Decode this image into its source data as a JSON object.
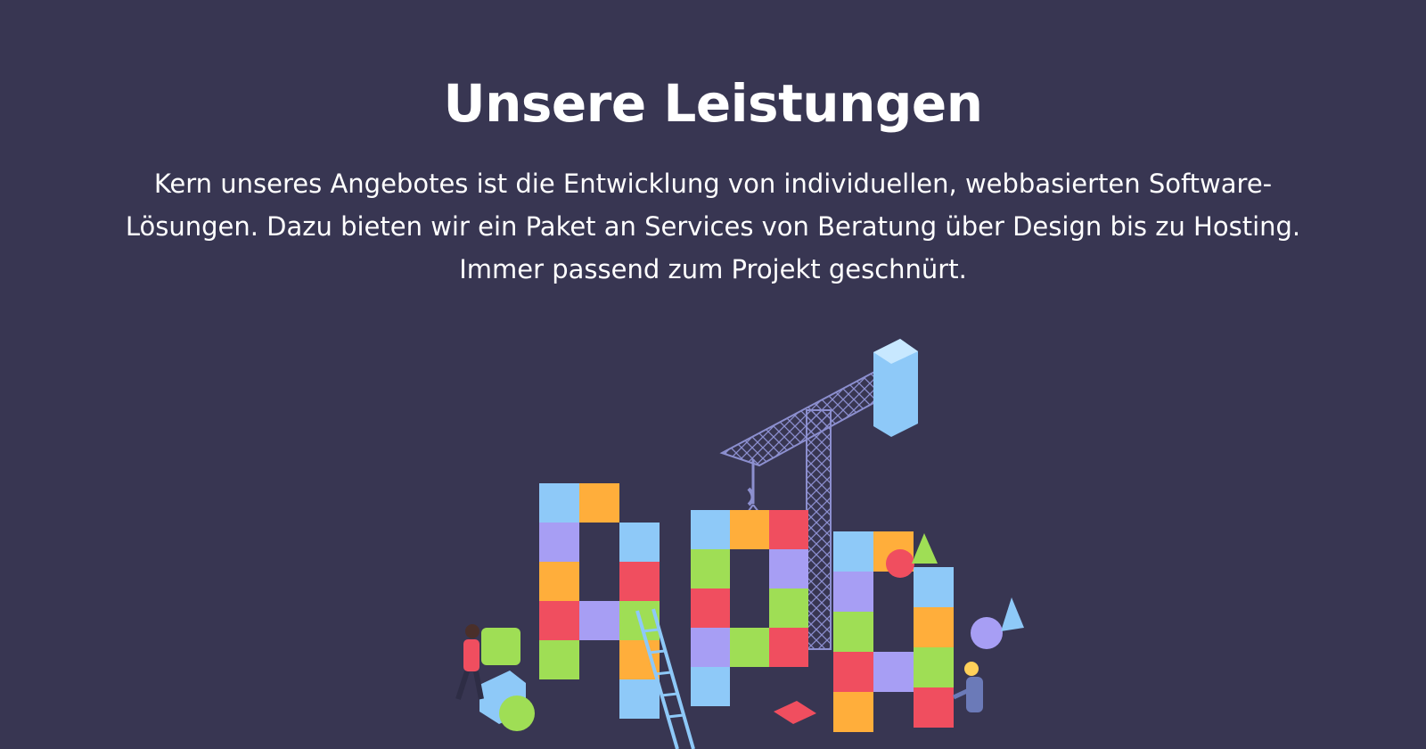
{
  "services": {
    "title": "Unsere Leistungen",
    "intro_lines": [
      "Kern unseres Angebotes ist die Entwicklung von individuellen, webbasierten Software-",
      "Lösungen. Dazu bieten wir ein Paket an Services von Beratung über Design bis zu Hosting.",
      "Immer passend zum Projekt geschnürt."
    ]
  },
  "colors": {
    "background": "#383652",
    "text": "#ffffff",
    "crane": "#8c8fcf",
    "block_blue": "#8ec9f8",
    "block_red": "#f04e5f",
    "block_orange": "#ffae3b",
    "block_green": "#9fde55",
    "block_purple": "#a79ef4"
  },
  "illustration": {
    "icons": [
      "crane-icon",
      "toy-block-icon",
      "worker-figure-icon",
      "ladder-icon",
      "ball-icon",
      "cone-icon"
    ]
  }
}
